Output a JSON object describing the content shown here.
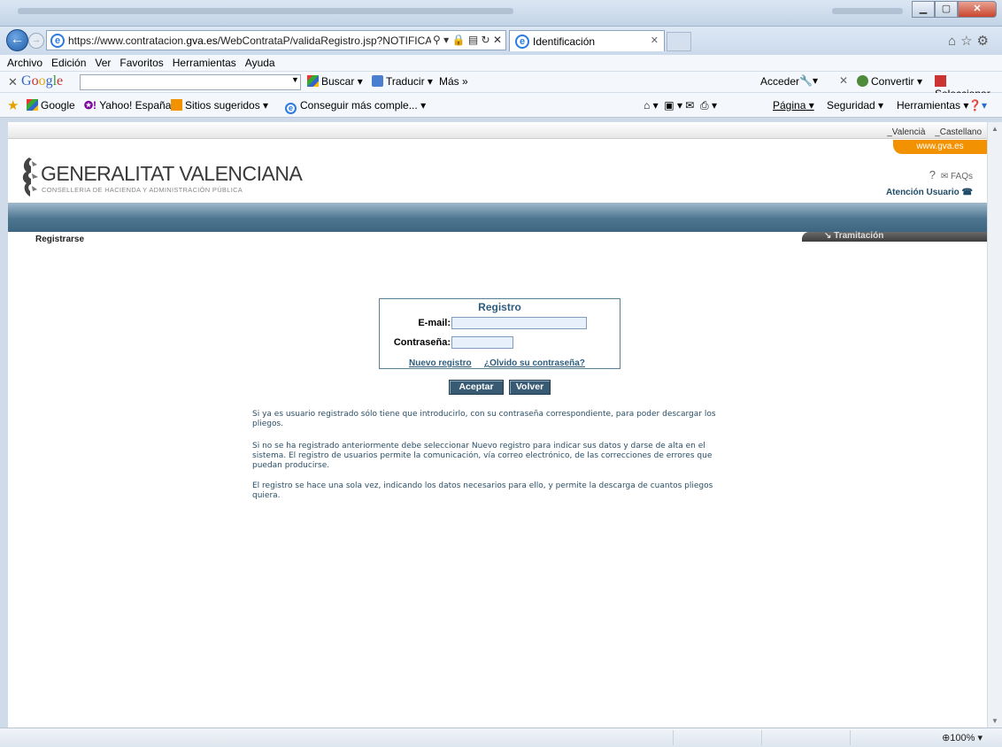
{
  "browser": {
    "address_prefix": "https://www.contratacion.",
    "address_host": "gva.es",
    "address_path": "/WebContrataP/validaRegistro.jsp?NOTIFICAI",
    "tab_title": "Identificación",
    "menu": [
      "Archivo",
      "Edición",
      "Ver",
      "Favoritos",
      "Herramientas",
      "Ayuda"
    ],
    "google_toolbar": {
      "logo": "Google",
      "buscar": "Buscar",
      "traducir": "Traducir",
      "mas": "Más",
      "acceder": "Acceder",
      "convertir": "Convertir",
      "seleccionar": "Seleccionar"
    },
    "favorites": {
      "google": "Google",
      "yahoo": "Yahoo! España",
      "sugeridos": "Sitios sugeridos",
      "conseguir": "Conseguir más comple...",
      "pagina": "Página",
      "seguridad": "Seguridad",
      "herramientas": "Herramientas"
    },
    "zoom": "100%"
  },
  "header": {
    "lang_valencia": "_Valencià",
    "lang_castellano": "_Castellano",
    "site_tab": "www.gva.es",
    "logo_title": "GENERALITAT VALENCIANA",
    "logo_subtitle": "CONSELLERIA DE HACIENDA Y ADMINISTRACIÓN PÚBLICA",
    "faqs": "FAQs",
    "atencion": "Atención Usuario",
    "tramitacion": "Tramitación",
    "registrarse": "Registrarse"
  },
  "form": {
    "title": "Registro",
    "email_label": "E-mail:",
    "email_value": "",
    "password_label": "Contraseña:",
    "password_value": "",
    "nuevo_registro": "Nuevo registro",
    "olvido": "¿Olvido su contraseña?",
    "aceptar": "Aceptar",
    "volver": "Volver"
  },
  "info": {
    "p1": "Si ya es usuario registrado sólo tiene que introducirlo, con su contraseña correspondiente, para poder descargar los pliegos.",
    "p2": "Si no se ha registrado anteriormente debe seleccionar Nuevo registro para indicar sus datos y darse de alta en el sistema. El registro de usuarios permite la comunicación, vía correo electrónico, de las correcciones de errores que puedan producirse.",
    "p3": "El registro se hace una sola vez, indicando los datos necesarios para ello, y permite la descarga de cuantos pliegos quiera."
  },
  "colors": {
    "accent_orange": "#f39200",
    "brand_blue": "#2e5d7c",
    "header_bar": "#4d7590"
  }
}
